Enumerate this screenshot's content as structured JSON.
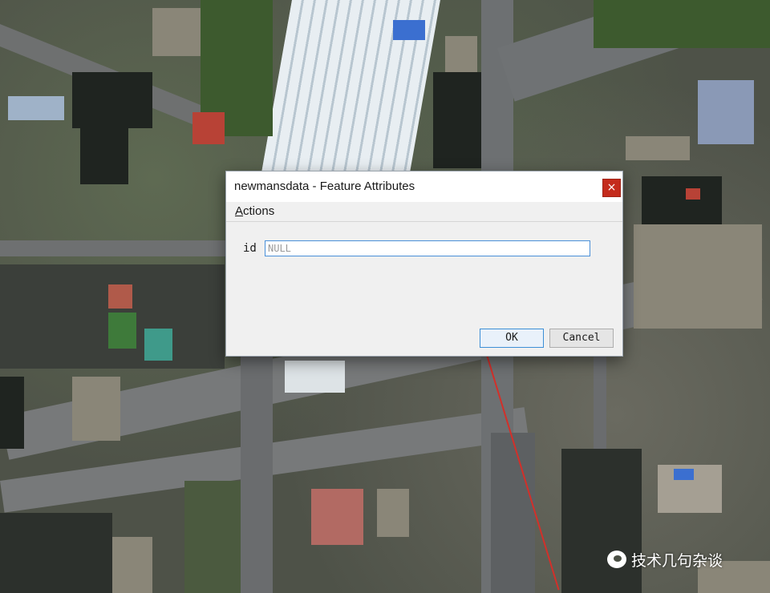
{
  "dialog": {
    "title": "newmansdata - Feature Attributes",
    "close_glyph": "×",
    "menu": {
      "actions_accel": "A",
      "actions_rest": "ctions"
    },
    "field": {
      "label": "id",
      "placeholder": "NULL",
      "value": ""
    },
    "buttons": {
      "ok": "OK",
      "cancel": "Cancel"
    }
  },
  "watermark": {
    "text": "技术几句杂谈",
    "icon": "wechat-icon"
  },
  "colors": {
    "close_button": "#c42b1c",
    "input_focus_border": "#4a90d9",
    "route_line": "#d2302a"
  }
}
